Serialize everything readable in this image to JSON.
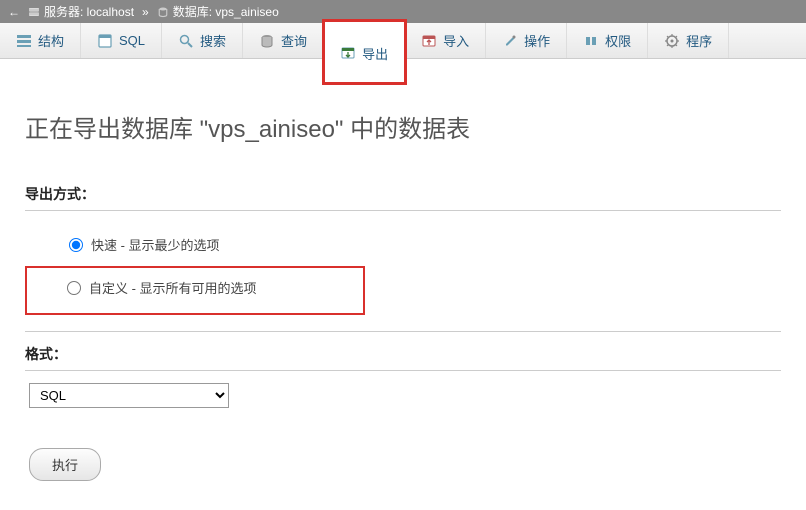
{
  "breadcrumb": {
    "server_label": "服务器: localhost",
    "separator": "»",
    "db_label": "数据库: vps_ainiseo"
  },
  "tabs": [
    {
      "id": "structure",
      "label": "结构",
      "icon": "structure-icon"
    },
    {
      "id": "sql",
      "label": "SQL",
      "icon": "sql-icon"
    },
    {
      "id": "search",
      "label": "搜索",
      "icon": "search-icon"
    },
    {
      "id": "query",
      "label": "查询",
      "icon": "query-icon"
    },
    {
      "id": "export",
      "label": "导出",
      "icon": "export-icon",
      "active": true
    },
    {
      "id": "import",
      "label": "导入",
      "icon": "import-icon"
    },
    {
      "id": "operations",
      "label": "操作",
      "icon": "operations-icon"
    },
    {
      "id": "privileges",
      "label": "权限",
      "icon": "privileges-icon"
    },
    {
      "id": "routines",
      "label": "程序",
      "icon": "routines-icon"
    }
  ],
  "page_title": "正在导出数据库 \"vps_ainiseo\" 中的数据表",
  "export_method": {
    "heading": "导出方式：",
    "quick_label": "快速 - 显示最少的选项",
    "custom_label": "自定义 - 显示所有可用的选项",
    "selected": "quick"
  },
  "format": {
    "heading": "格式：",
    "selected": "SQL",
    "options": [
      "SQL"
    ]
  },
  "submit_label": "执行"
}
